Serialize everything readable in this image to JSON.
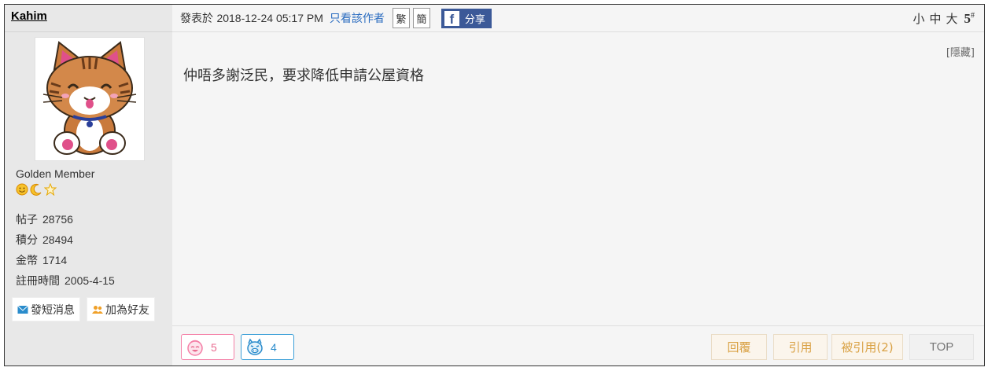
{
  "author": {
    "name": "Kahim",
    "rank": "Golden Member",
    "badges": [
      "smiley-face-badge",
      "crescent-moon-badge",
      "star-badge"
    ],
    "stats": [
      {
        "label": "帖子",
        "value": "28756"
      },
      {
        "label": "積分",
        "value": "28494"
      },
      {
        "label": "金幣",
        "value": "1714"
      },
      {
        "label": "註冊時間",
        "value": "2005-4-15"
      }
    ],
    "send_message": "發短消息",
    "add_friend": "加為好友"
  },
  "post": {
    "posted_prefix": "發表於",
    "posted_time": "2018-12-24 05:17 PM",
    "only_author": "只看該作者",
    "traditional": "繁",
    "simplified": "簡",
    "share_label": "分享",
    "size_small": "小",
    "size_medium": "中",
    "size_large": "大",
    "floor": "5",
    "floor_mark": "#",
    "hide": "[隱藏]",
    "content": "仲唔多謝泛民，要求降低申請公屋資格"
  },
  "footer": {
    "like_count": "5",
    "dislike_count": "4",
    "reply": "回覆",
    "quote": "引用",
    "quoted": "被引用(2)",
    "top": "TOP"
  },
  "colors": {
    "facebook": "#3b5998",
    "like": "#e96a8f",
    "dislike": "#2a8ccc",
    "action_text": "#d9a144",
    "link": "#2a6cc0"
  }
}
